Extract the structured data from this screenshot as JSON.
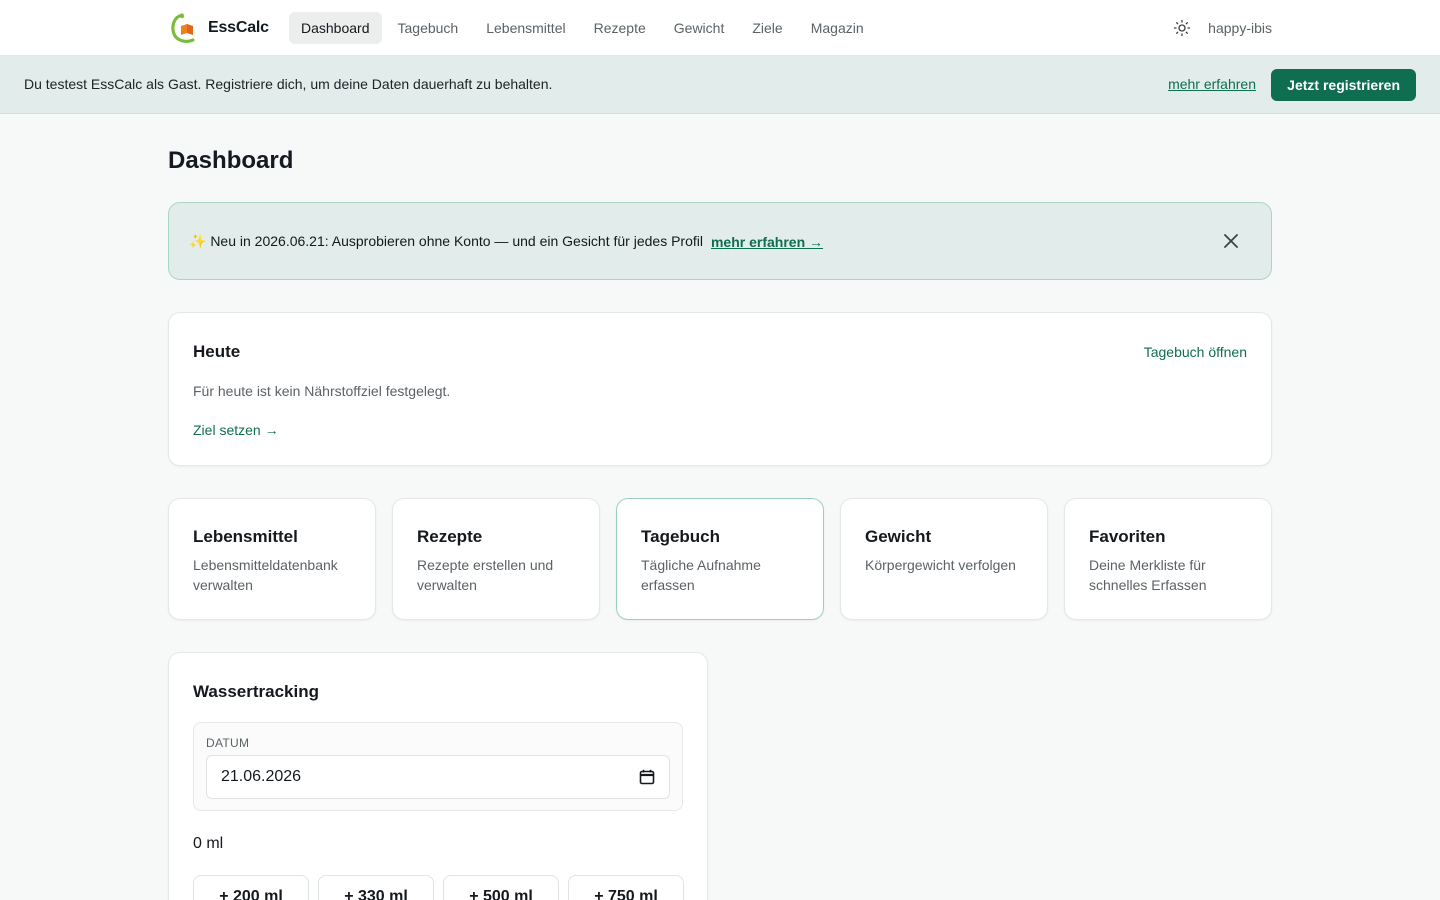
{
  "brand": {
    "name": "EssCalc",
    "logo_icon": "esscalc-logo-icon"
  },
  "nav": {
    "items": [
      {
        "label": "Dashboard",
        "active": true
      },
      {
        "label": "Tagebuch",
        "active": false
      },
      {
        "label": "Lebensmittel",
        "active": false
      },
      {
        "label": "Rezepte",
        "active": false
      },
      {
        "label": "Gewicht",
        "active": false
      },
      {
        "label": "Ziele",
        "active": false
      },
      {
        "label": "Magazin",
        "active": false
      }
    ],
    "theme_icon": "sun-icon",
    "username": "happy-ibis"
  },
  "guest_banner": {
    "text": "Du testest EssCalc als Gast. Registriere dich, um deine Daten dauerhaft zu behalten.",
    "more_link": "mehr erfahren",
    "register_button": "Jetzt registrieren"
  },
  "page": {
    "title": "Dashboard"
  },
  "news": {
    "text": "✨ Neu in 2026.06.21: Ausprobieren ohne Konto — und ein Gesicht für jedes Profil",
    "link": "mehr erfahren →",
    "close_icon": "close-icon"
  },
  "today": {
    "title": "Heute",
    "open_link": "Tagebuch öffnen",
    "empty_text": "Für heute ist kein Nährstoffziel festgelegt.",
    "goal_link": "Ziel setzen →"
  },
  "tiles": [
    {
      "title": "Lebensmittel",
      "description": "Lebensmitteldatenbank verwalten"
    },
    {
      "title": "Rezepte",
      "description": "Rezepte erstellen und verwalten"
    },
    {
      "title": "Tagebuch",
      "description": "Tägliche Aufnahme erfassen"
    },
    {
      "title": "Gewicht",
      "description": "Körpergewicht verfolgen"
    },
    {
      "title": "Favoriten",
      "description": "Deine Merkliste für schnelles Erfassen"
    }
  ],
  "water": {
    "title": "Wassertracking",
    "date_label": "DATUM",
    "date_value": "21.06.2026",
    "calendar_icon": "calendar-icon",
    "amount": "0 ml",
    "buttons": [
      "+ 200 ml",
      "+ 330 ml",
      "+ 500 ml",
      "+ 750 ml"
    ]
  },
  "colors": {
    "accent": "#0f6e4f",
    "banner_background": "#e2ecea",
    "page_background": "#f7f8f8"
  }
}
